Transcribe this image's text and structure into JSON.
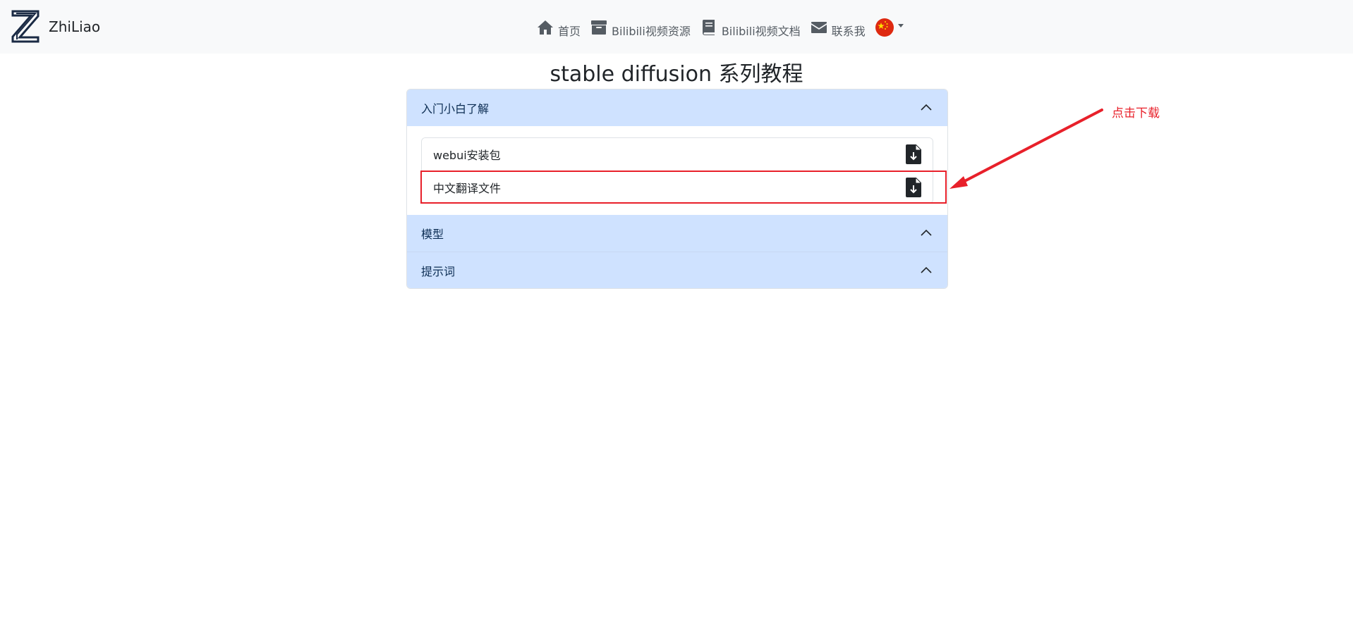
{
  "navbar": {
    "brand_name": "ZhiLiao",
    "items": [
      {
        "label": "首页",
        "icon": "home-icon"
      },
      {
        "label": "Bilibili视频资源",
        "icon": "archive-box-icon"
      },
      {
        "label": "Bilibili视频文档",
        "icon": "book-icon"
      },
      {
        "label": "联系我",
        "icon": "envelope-icon"
      }
    ],
    "language_icon": "china-flag-icon"
  },
  "page_title": "stable diffusion 系列教程",
  "accordion": {
    "sections": [
      {
        "title": "入门小白了解",
        "expanded": true,
        "files": [
          {
            "name": "webui安装包",
            "icon": "file-download-icon"
          },
          {
            "name": "中文翻译文件",
            "icon": "file-download-icon"
          }
        ]
      },
      {
        "title": "模型",
        "expanded": false
      },
      {
        "title": "提示词",
        "expanded": false
      }
    ]
  },
  "annotation": {
    "text": "点击下载",
    "color": "#e8202a"
  },
  "colors": {
    "accordion_header_bg": "#cfe2ff",
    "navbar_bg": "#f8f9fa",
    "annotation_red": "#e8202a"
  }
}
